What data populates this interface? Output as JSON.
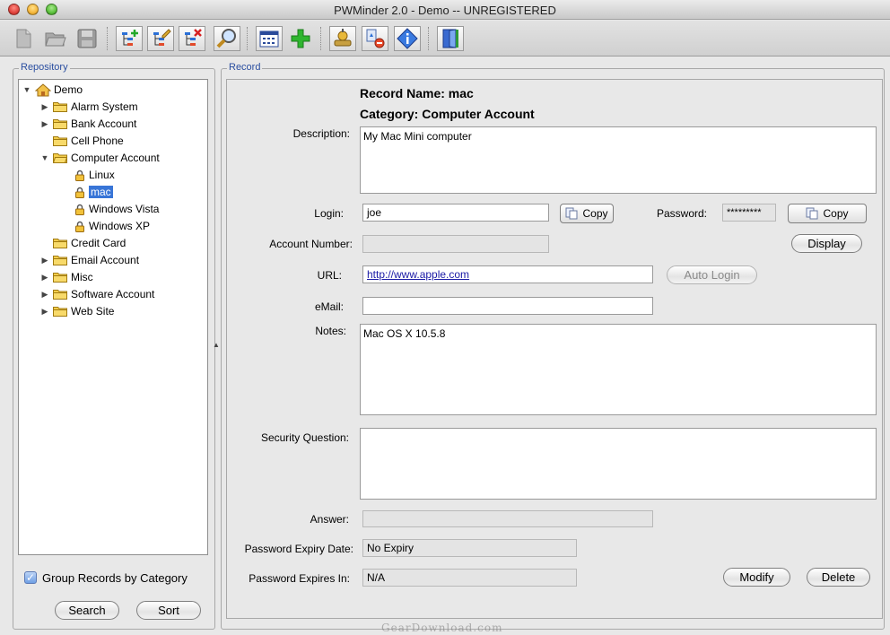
{
  "window": {
    "title": "PWMinder 2.0 - Demo -- UNREGISTERED"
  },
  "toolbar": {
    "icons": [
      "new-file-icon",
      "open-folder-icon",
      "save-disk-icon",
      "add-record-icon",
      "edit-record-icon",
      "delete-record-icon",
      "search-magnifier-icon",
      "calendar-icon",
      "add-plus-icon",
      "settings-tool-icon",
      "import-export-icon",
      "info-icon",
      "exit-door-icon"
    ]
  },
  "repository": {
    "title": "Repository",
    "tree": [
      {
        "label": "Demo",
        "level": 0,
        "expander": "open",
        "icon": "home"
      },
      {
        "label": "Alarm System",
        "level": 1,
        "expander": "closed",
        "icon": "folder"
      },
      {
        "label": "Bank Account",
        "level": 1,
        "expander": "closed",
        "icon": "folder"
      },
      {
        "label": "Cell Phone",
        "level": 1,
        "expander": "none",
        "icon": "folder"
      },
      {
        "label": "Computer Account",
        "level": 1,
        "expander": "open",
        "icon": "folder"
      },
      {
        "label": "Linux",
        "level": 2,
        "expander": "none",
        "icon": "lock"
      },
      {
        "label": "mac",
        "level": 2,
        "expander": "none",
        "icon": "lock",
        "selected": true
      },
      {
        "label": "Windows Vista",
        "level": 2,
        "expander": "none",
        "icon": "lock"
      },
      {
        "label": "Windows XP",
        "level": 2,
        "expander": "none",
        "icon": "lock"
      },
      {
        "label": "Credit Card",
        "level": 1,
        "expander": "none",
        "icon": "folder"
      },
      {
        "label": "Email Account",
        "level": 1,
        "expander": "closed",
        "icon": "folder"
      },
      {
        "label": "Misc",
        "level": 1,
        "expander": "closed",
        "icon": "folder"
      },
      {
        "label": "Software Account",
        "level": 1,
        "expander": "closed",
        "icon": "folder"
      },
      {
        "label": "Web Site",
        "level": 1,
        "expander": "closed",
        "icon": "folder"
      }
    ],
    "group_checkbox": {
      "label": "Group Records by Category",
      "checked": true
    },
    "search_label": "Search",
    "sort_label": "Sort"
  },
  "record": {
    "title": "Record",
    "record_name": "Record Name: mac",
    "category": "Category: Computer Account",
    "description_label": "Description:",
    "description": "My Mac Mini computer",
    "login_label": "Login:",
    "login": "joe",
    "copy_label": "Copy",
    "password_label": "Password:",
    "password_masked": "*********",
    "account_number_label": "Account Number:",
    "account_number": "",
    "display_label": "Display",
    "url_label": "URL:",
    "url": "http://www.apple.com",
    "auto_login_label": "Auto Login",
    "email_label": "eMail:",
    "email": "",
    "notes_label": "Notes:",
    "notes": "Mac OS X 10.5.8",
    "security_question_label": "Security Question:",
    "security_question": "",
    "answer_label": "Answer:",
    "answer": "",
    "expiry_date_label": "Password Expiry Date:",
    "expiry_date": "No Expiry",
    "expires_in_label": "Password Expires In:",
    "expires_in": "N/A",
    "modify_label": "Modify",
    "delete_label": "Delete"
  },
  "watermark": "GearDownload.com"
}
